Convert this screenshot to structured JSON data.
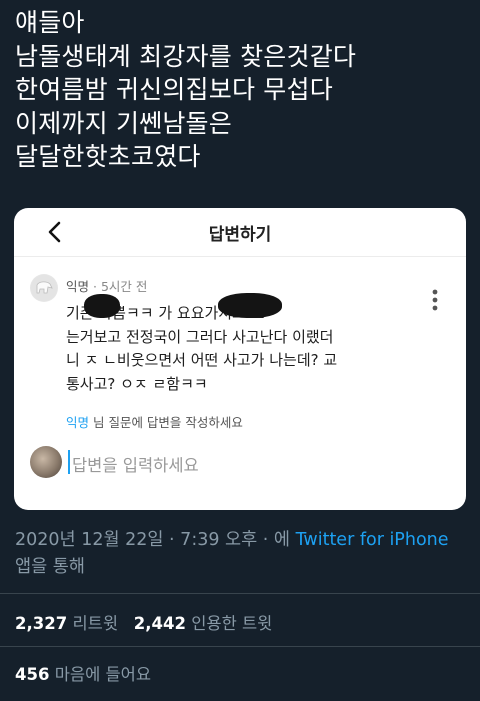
{
  "tweet": {
    "lines": [
      "얘들아",
      "남돌생태계 최강자를 찾은것같다",
      "한여름밤 귀신의집보다 무섭다",
      "이제까지 기쎈남돌은",
      "달달한핫초코였다"
    ]
  },
  "card": {
    "title": "답변하기",
    "comment": {
      "author": "익명",
      "time": "5시간 전",
      "body_lines": [
        "기존 나쁨ㅋㅋ            가 요요가지고 노",
        "는거보고 전정국이 그러다 사고난다 이랬더",
        "니 ㅈ ㄴ비웃으면서 어떤 사고가 나는데? 교",
        "통사고? ㅇㅈ ㄹ함ㅋㅋ"
      ]
    },
    "reply_hint": {
      "author": "익명",
      "text": " 님 질문에 답변을 작성하세요"
    },
    "input_placeholder": "답변을 입력하세요"
  },
  "meta": {
    "date_line": "2020년 12월 22일 · 7:39 오후 · 에 ",
    "source": "Twitter for iPhone",
    "suffix": " 앱을 통해"
  },
  "stats": {
    "retweets": "2,327",
    "retweets_label": "리트윗",
    "quotes": "2,442",
    "quotes_label": "인용한 트윗",
    "likes": "456",
    "likes_label": "마음에 들어요"
  },
  "colors": {
    "background": "#15202b",
    "accent": "#1da1f2",
    "muted": "#8899a6"
  },
  "icons": [
    "back-arrow-icon",
    "more-vertical-icon",
    "anonymous-avatar-icon"
  ]
}
